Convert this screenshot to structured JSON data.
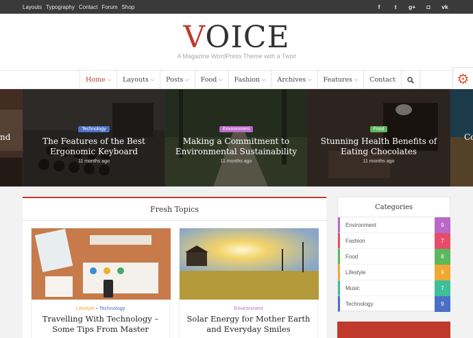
{
  "topbar": {
    "links": [
      "Layouts",
      "Typography",
      "Contact",
      "Forum",
      "Shop"
    ],
    "socials": [
      {
        "icon": "facebook-icon",
        "glyph": "f"
      },
      {
        "icon": "twitter-icon",
        "glyph": "t"
      },
      {
        "icon": "google-plus-icon",
        "glyph": "g+"
      },
      {
        "icon": "instagram-icon",
        "glyph": "◘"
      },
      {
        "icon": "vk-icon",
        "glyph": "vk"
      }
    ]
  },
  "header": {
    "logo_first": "V",
    "logo_rest": "OICE",
    "tagline": "A Magazine WordPress Theme with a Twist"
  },
  "nav": {
    "items": [
      {
        "label": "Home",
        "dropdown": true,
        "active": true
      },
      {
        "label": "Layouts",
        "dropdown": true
      },
      {
        "label": "Posts",
        "dropdown": true
      },
      {
        "label": "Food",
        "dropdown": true
      },
      {
        "label": "Fashion",
        "dropdown": true
      },
      {
        "label": "Archives",
        "dropdown": true
      },
      {
        "label": "Features",
        "dropdown": true
      },
      {
        "label": "Contact",
        "dropdown": false
      }
    ],
    "search_icon": "search-icon",
    "settings_icon": "gear-icon"
  },
  "slider": {
    "left_edge_text": "nd",
    "right_edge_text": "Co",
    "slides": [
      {
        "category": "Technology",
        "category_color": "#4b6fc7",
        "title": "The Features of the Best Ergonomic Keyboard",
        "date": "11 months ago"
      },
      {
        "category": "Environment",
        "category_color": "#b968c7",
        "title": "Making a Commitment to Environmental Sustainability",
        "date": "11 months ago"
      },
      {
        "category": "Food",
        "category_color": "#5cb85c",
        "title": "Stunning Health Benefits of Eating Chocolates",
        "date": "11 months ago"
      }
    ]
  },
  "fresh": {
    "heading": "Fresh Topics",
    "cards": [
      {
        "cat1": "Lifestyle",
        "cat1_color": "#f0a830",
        "sep": " • ",
        "cat2": "Technology",
        "cat2_color": "#4b6fc7",
        "title": "Travelling With Technology – Some Tips From Master"
      },
      {
        "cat1": "Environment",
        "cat1_color": "#b968c7",
        "sep": "",
        "cat2": "",
        "cat2_color": "#4b6fc7",
        "title": "Solar Energy for Mother Earth and Everyday Smiles"
      }
    ]
  },
  "categories": {
    "heading": "Categories",
    "items": [
      {
        "name": "Environment",
        "count": "9",
        "color": "#b968c7"
      },
      {
        "name": "Fashion",
        "count": "7",
        "color": "#e84c6b"
      },
      {
        "name": "Food",
        "count": "8",
        "color": "#5cb85c"
      },
      {
        "name": "Lifestyle",
        "count": "9",
        "color": "#f0a830"
      },
      {
        "name": "Music",
        "count": "7",
        "color": "#3cbf9a"
      },
      {
        "name": "Technology",
        "count": "9",
        "color": "#4b6fc7"
      }
    ]
  },
  "colors": {
    "accent": "#c0392b",
    "topbar": "#3a3a3a",
    "settings": "#e0552b"
  }
}
